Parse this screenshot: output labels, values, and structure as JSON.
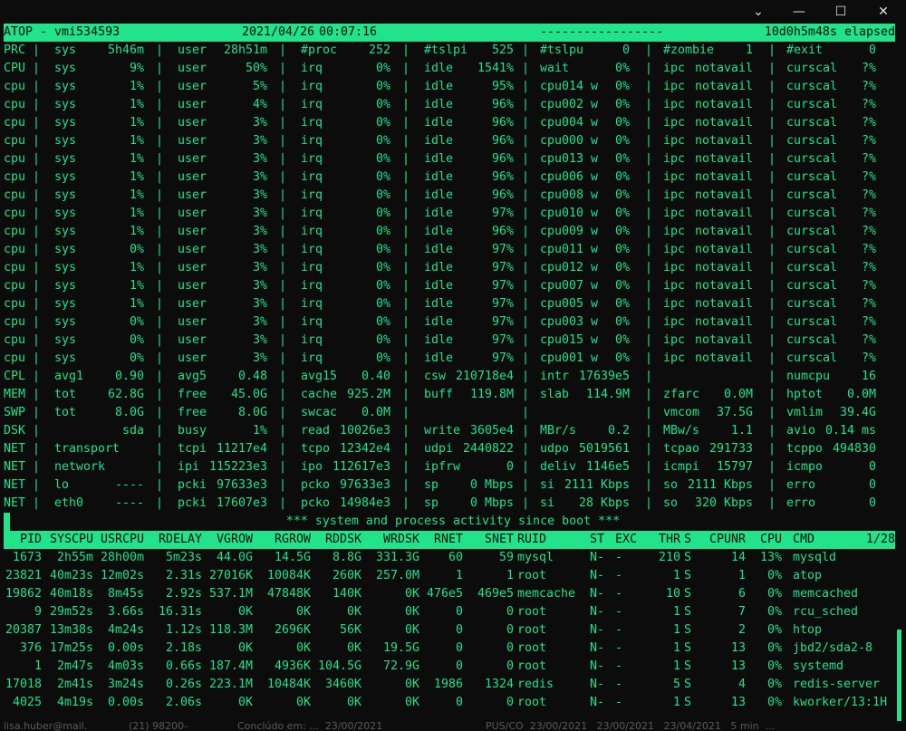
{
  "window": {
    "controls": {
      "dropdown": "⌄",
      "minimize": "—",
      "maximize": "☐",
      "close": "✕"
    }
  },
  "header": {
    "host": "ATOP - vmi534593",
    "date": "2021/04/26",
    "time": "00:07:16",
    "dashes": "-----------------",
    "elapsed": "10d0h5m48s elapsed"
  },
  "system_rows": [
    {
      "label": "PRC",
      "f": [
        [
          "sys",
          "5h46m"
        ],
        [
          "user",
          "28h51m"
        ],
        [
          "#proc",
          "252"
        ],
        [
          "#tslpi",
          "525"
        ],
        [
          "#tslpu",
          "0"
        ],
        [
          "#zombie",
          "1"
        ],
        [
          "#exit",
          "0"
        ]
      ]
    },
    {
      "label": "CPU",
      "f": [
        [
          "sys",
          "9%"
        ],
        [
          "user",
          "50%"
        ],
        [
          "irq",
          "0%"
        ],
        [
          "idle",
          "1541%"
        ],
        [
          "wait",
          "0%"
        ],
        [
          "ipc",
          "notavail"
        ],
        [
          "curscal",
          "?%"
        ]
      ]
    },
    {
      "label": "cpu",
      "f": [
        [
          "sys",
          "1%"
        ],
        [
          "user",
          "5%"
        ],
        [
          "irq",
          "0%"
        ],
        [
          "idle",
          "95%"
        ],
        [
          "cpu014 w",
          "0%"
        ],
        [
          "ipc",
          "notavail"
        ],
        [
          "curscal",
          "?%"
        ]
      ]
    },
    {
      "label": "cpu",
      "f": [
        [
          "sys",
          "1%"
        ],
        [
          "user",
          "4%"
        ],
        [
          "irq",
          "0%"
        ],
        [
          "idle",
          "96%"
        ],
        [
          "cpu002 w",
          "0%"
        ],
        [
          "ipc",
          "notavail"
        ],
        [
          "curscal",
          "?%"
        ]
      ]
    },
    {
      "label": "cpu",
      "f": [
        [
          "sys",
          "1%"
        ],
        [
          "user",
          "3%"
        ],
        [
          "irq",
          "0%"
        ],
        [
          "idle",
          "96%"
        ],
        [
          "cpu004 w",
          "0%"
        ],
        [
          "ipc",
          "notavail"
        ],
        [
          "curscal",
          "?%"
        ]
      ]
    },
    {
      "label": "cpu",
      "f": [
        [
          "sys",
          "1%"
        ],
        [
          "user",
          "3%"
        ],
        [
          "irq",
          "0%"
        ],
        [
          "idle",
          "96%"
        ],
        [
          "cpu000 w",
          "0%"
        ],
        [
          "ipc",
          "notavail"
        ],
        [
          "curscal",
          "?%"
        ]
      ]
    },
    {
      "label": "cpu",
      "f": [
        [
          "sys",
          "1%"
        ],
        [
          "user",
          "3%"
        ],
        [
          "irq",
          "0%"
        ],
        [
          "idle",
          "96%"
        ],
        [
          "cpu013 w",
          "0%"
        ],
        [
          "ipc",
          "notavail"
        ],
        [
          "curscal",
          "?%"
        ]
      ]
    },
    {
      "label": "cpu",
      "f": [
        [
          "sys",
          "1%"
        ],
        [
          "user",
          "3%"
        ],
        [
          "irq",
          "0%"
        ],
        [
          "idle",
          "96%"
        ],
        [
          "cpu006 w",
          "0%"
        ],
        [
          "ipc",
          "notavail"
        ],
        [
          "curscal",
          "?%"
        ]
      ]
    },
    {
      "label": "cpu",
      "f": [
        [
          "sys",
          "1%"
        ],
        [
          "user",
          "3%"
        ],
        [
          "irq",
          "0%"
        ],
        [
          "idle",
          "96%"
        ],
        [
          "cpu008 w",
          "0%"
        ],
        [
          "ipc",
          "notavail"
        ],
        [
          "curscal",
          "?%"
        ]
      ]
    },
    {
      "label": "cpu",
      "f": [
        [
          "sys",
          "1%"
        ],
        [
          "user",
          "3%"
        ],
        [
          "irq",
          "0%"
        ],
        [
          "idle",
          "97%"
        ],
        [
          "cpu010 w",
          "0%"
        ],
        [
          "ipc",
          "notavail"
        ],
        [
          "curscal",
          "?%"
        ]
      ]
    },
    {
      "label": "cpu",
      "f": [
        [
          "sys",
          "1%"
        ],
        [
          "user",
          "3%"
        ],
        [
          "irq",
          "0%"
        ],
        [
          "idle",
          "96%"
        ],
        [
          "cpu009 w",
          "0%"
        ],
        [
          "ipc",
          "notavail"
        ],
        [
          "curscal",
          "?%"
        ]
      ]
    },
    {
      "label": "cpu",
      "f": [
        [
          "sys",
          "0%"
        ],
        [
          "user",
          "3%"
        ],
        [
          "irq",
          "0%"
        ],
        [
          "idle",
          "97%"
        ],
        [
          "cpu011 w",
          "0%"
        ],
        [
          "ipc",
          "notavail"
        ],
        [
          "curscal",
          "?%"
        ]
      ]
    },
    {
      "label": "cpu",
      "f": [
        [
          "sys",
          "1%"
        ],
        [
          "user",
          "3%"
        ],
        [
          "irq",
          "0%"
        ],
        [
          "idle",
          "97%"
        ],
        [
          "cpu012 w",
          "0%"
        ],
        [
          "ipc",
          "notavail"
        ],
        [
          "curscal",
          "?%"
        ]
      ]
    },
    {
      "label": "cpu",
      "f": [
        [
          "sys",
          "1%"
        ],
        [
          "user",
          "3%"
        ],
        [
          "irq",
          "0%"
        ],
        [
          "idle",
          "97%"
        ],
        [
          "cpu007 w",
          "0%"
        ],
        [
          "ipc",
          "notavail"
        ],
        [
          "curscal",
          "?%"
        ]
      ]
    },
    {
      "label": "cpu",
      "f": [
        [
          "sys",
          "1%"
        ],
        [
          "user",
          "3%"
        ],
        [
          "irq",
          "0%"
        ],
        [
          "idle",
          "97%"
        ],
        [
          "cpu005 w",
          "0%"
        ],
        [
          "ipc",
          "notavail"
        ],
        [
          "curscal",
          "?%"
        ]
      ]
    },
    {
      "label": "cpu",
      "f": [
        [
          "sys",
          "0%"
        ],
        [
          "user",
          "3%"
        ],
        [
          "irq",
          "0%"
        ],
        [
          "idle",
          "97%"
        ],
        [
          "cpu003 w",
          "0%"
        ],
        [
          "ipc",
          "notavail"
        ],
        [
          "curscal",
          "?%"
        ]
      ]
    },
    {
      "label": "cpu",
      "f": [
        [
          "sys",
          "0%"
        ],
        [
          "user",
          "3%"
        ],
        [
          "irq",
          "0%"
        ],
        [
          "idle",
          "97%"
        ],
        [
          "cpu015 w",
          "0%"
        ],
        [
          "ipc",
          "notavail"
        ],
        [
          "curscal",
          "?%"
        ]
      ]
    },
    {
      "label": "cpu",
      "f": [
        [
          "sys",
          "0%"
        ],
        [
          "user",
          "3%"
        ],
        [
          "irq",
          "0%"
        ],
        [
          "idle",
          "97%"
        ],
        [
          "cpu001 w",
          "0%"
        ],
        [
          "ipc",
          "notavail"
        ],
        [
          "curscal",
          "?%"
        ]
      ]
    },
    {
      "label": "CPL",
      "f": [
        [
          "avg1",
          "0.90"
        ],
        [
          "avg5",
          "0.48"
        ],
        [
          "avg15",
          "0.40"
        ],
        [
          "csw",
          "210718e4"
        ],
        [
          "intr",
          "17639e5"
        ],
        [
          "",
          ""
        ],
        [
          "numcpu",
          "16"
        ]
      ]
    },
    {
      "label": "MEM",
      "f": [
        [
          "tot",
          "62.8G"
        ],
        [
          "free",
          "45.0G"
        ],
        [
          "cache",
          "925.2M"
        ],
        [
          "buff",
          "119.8M"
        ],
        [
          "slab",
          "114.9M"
        ],
        [
          "zfarc",
          "0.0M"
        ],
        [
          "hptot",
          "0.0M"
        ]
      ]
    },
    {
      "label": "SWP",
      "f": [
        [
          "tot",
          "8.0G"
        ],
        [
          "free",
          "8.0G"
        ],
        [
          "swcac",
          "0.0M"
        ],
        [
          "",
          ""
        ],
        [
          "",
          ""
        ],
        [
          "vmcom",
          "37.5G"
        ],
        [
          "vmlim",
          "39.4G"
        ]
      ]
    },
    {
      "label": "DSK",
      "f": [
        [
          "",
          "sda"
        ],
        [
          "busy",
          "1%"
        ],
        [
          "read",
          "10026e3"
        ],
        [
          "write",
          "3605e4"
        ],
        [
          "MBr/s",
          "0.2"
        ],
        [
          "MBw/s",
          "1.1"
        ],
        [
          "avio",
          "0.14 ms"
        ]
      ]
    },
    {
      "label": "NET",
      "f": [
        [
          "transport",
          ""
        ],
        [
          "tcpi",
          "11217e4"
        ],
        [
          "tcpo",
          "12342e4"
        ],
        [
          "udpi",
          "2440822"
        ],
        [
          "udpo",
          "5019561"
        ],
        [
          "tcpao",
          "291733"
        ],
        [
          "tcppo",
          "494830"
        ]
      ]
    },
    {
      "label": "NET",
      "f": [
        [
          "network",
          ""
        ],
        [
          "ipi",
          "115223e3"
        ],
        [
          "ipo",
          "112617e3"
        ],
        [
          "ipfrw",
          "0"
        ],
        [
          "deliv",
          "1146e5"
        ],
        [
          "icmpi",
          "15797"
        ],
        [
          "icmpo",
          "0"
        ]
      ]
    },
    {
      "label": "NET",
      "f": [
        [
          "lo",
          "----"
        ],
        [
          "pcki",
          "97633e3"
        ],
        [
          "pcko",
          "97633e3"
        ],
        [
          "sp",
          "0 Mbps"
        ],
        [
          "si",
          "2111 Kbps"
        ],
        [
          "so",
          "2111 Kbps"
        ],
        [
          "erro",
          "0"
        ]
      ]
    },
    {
      "label": "NET",
      "f": [
        [
          "eth0",
          "----"
        ],
        [
          "pcki",
          "17607e3"
        ],
        [
          "pcko",
          "14984e3"
        ],
        [
          "sp",
          "0 Mbps"
        ],
        [
          "si",
          "28 Kbps"
        ],
        [
          "so",
          "320 Kbps"
        ],
        [
          "erro",
          "0"
        ]
      ]
    }
  ],
  "banner": "*** system and process activity since boot ***",
  "process_table": {
    "columns": [
      "PID",
      "SYSCPU",
      "USRCPU",
      "RDELAY",
      "VGROW",
      "RGROW",
      "RDDSK",
      "WRDSK",
      "RNET",
      "SNET",
      "RUID",
      "ST",
      "EXC",
      "THR",
      "S",
      "CPUNR",
      "CPU",
      "CMD"
    ],
    "page": "1/28",
    "rows": [
      [
        "1673",
        "2h55m",
        "28h00m",
        "5m23s",
        "44.0G",
        "14.5G",
        "8.8G",
        "331.3G",
        "60",
        "59",
        "mysql",
        "N-",
        "-",
        "210",
        "S",
        "14",
        "13%",
        "mysqld"
      ],
      [
        "23821",
        "40m23s",
        "12m02s",
        "2.31s",
        "27016K",
        "10084K",
        "260K",
        "257.0M",
        "1",
        "1",
        "root",
        "N-",
        "-",
        "1",
        "S",
        "1",
        "0%",
        "atop"
      ],
      [
        "19862",
        "40m18s",
        "8m45s",
        "2.92s",
        "537.1M",
        "47848K",
        "140K",
        "0K",
        "476e5",
        "469e5",
        "memcache",
        "N-",
        "-",
        "10",
        "S",
        "6",
        "0%",
        "memcached"
      ],
      [
        "9",
        "29m52s",
        "3.66s",
        "16.31s",
        "0K",
        "0K",
        "0K",
        "0K",
        "0",
        "0",
        "root",
        "N-",
        "-",
        "1",
        "S",
        "7",
        "0%",
        "rcu_sched"
      ],
      [
        "20387",
        "13m38s",
        "4m24s",
        "1.12s",
        "118.3M",
        "2696K",
        "56K",
        "0K",
        "0",
        "0",
        "root",
        "N-",
        "-",
        "1",
        "S",
        "2",
        "0%",
        "htop"
      ],
      [
        "376",
        "17m25s",
        "0.00s",
        "2.18s",
        "0K",
        "0K",
        "0K",
        "19.5G",
        "0",
        "0",
        "root",
        "N-",
        "-",
        "1",
        "S",
        "13",
        "0%",
        "jbd2/sda2-8"
      ],
      [
        "1",
        "2m47s",
        "4m03s",
        "0.66s",
        "187.4M",
        "4936K",
        "104.5G",
        "72.9G",
        "0",
        "0",
        "root",
        "N-",
        "-",
        "1",
        "S",
        "13",
        "0%",
        "systemd"
      ],
      [
        "17018",
        "2m41s",
        "3m24s",
        "0.26s",
        "223.1M",
        "10484K",
        "3460K",
        "0K",
        "1986",
        "1324",
        "redis",
        "N-",
        "-",
        "5",
        "S",
        "4",
        "0%",
        "redis-server"
      ],
      [
        "4025",
        "4m19s",
        "0.00s",
        "2.06s",
        "0K",
        "0K",
        "0K",
        "0K",
        "0",
        "0",
        "root",
        "N-",
        "-",
        "1",
        "S",
        "13",
        "0%",
        "kworker/13:1H"
      ]
    ]
  },
  "taskbar_fragments": [
    "lisa.huber@mail.",
    "(21) 98200-",
    "Conclúdo em: ...  23/00/2021",
    "PÚS/CO  23/00/2021   23/00/2021   23/04/2021   5 min  ..."
  ]
}
